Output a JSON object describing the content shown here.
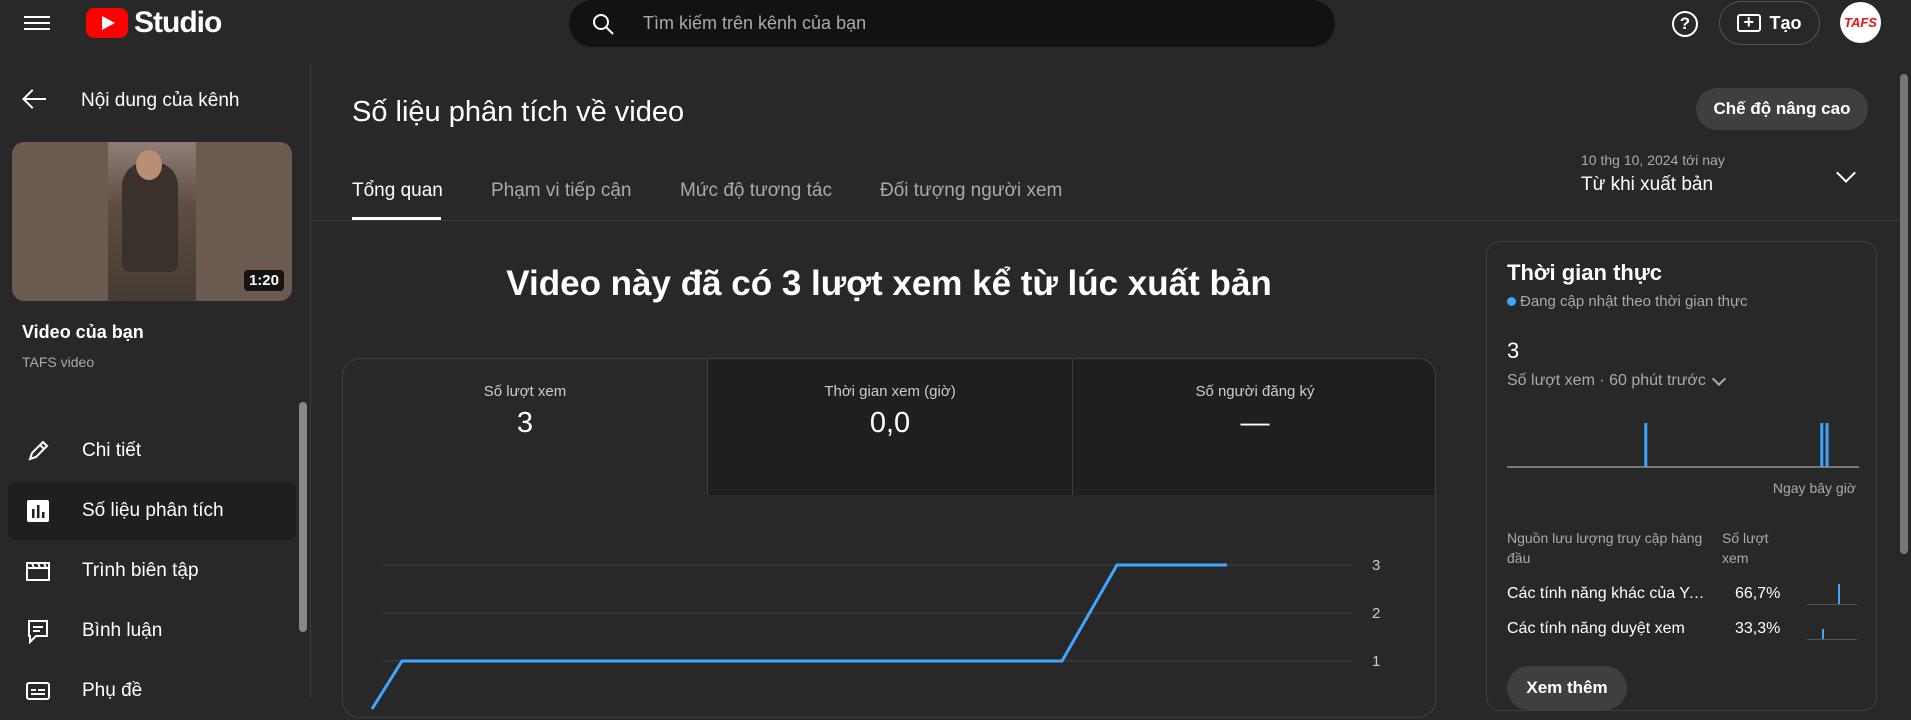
{
  "header": {
    "logo_text": "Studio",
    "search_placeholder": "Tìm kiếm trên kênh của bạn",
    "help_label": "?",
    "create_label": "Tạo",
    "avatar_text": "TAFS"
  },
  "sidebar": {
    "back_label": "Nội dung của kênh",
    "video_duration": "1:20",
    "video_title": "Video của bạn",
    "video_subtitle": "TAFS video",
    "items": [
      {
        "label": "Chi tiết",
        "icon": "pencil-icon"
      },
      {
        "label": "Số liệu phân tích",
        "icon": "analytics-icon"
      },
      {
        "label": "Trình biên tập",
        "icon": "editor-icon"
      },
      {
        "label": "Bình luận",
        "icon": "comments-icon"
      },
      {
        "label": "Phụ đề",
        "icon": "subtitles-icon"
      }
    ]
  },
  "main": {
    "title": "Số liệu phân tích về video",
    "advanced_button": "Chế độ nâng cao",
    "tabs": [
      {
        "label": "Tổng quan"
      },
      {
        "label": "Phạm vi tiếp cận"
      },
      {
        "label": "Mức độ tương tác"
      },
      {
        "label": "Đối tượng người xem"
      }
    ],
    "date_range": "10 thg 10, 2024 tới nay",
    "date_label": "Từ khi xuất bản",
    "headline": "Video này đã có 3 lượt xem kể từ lúc xuất bản",
    "stats": [
      {
        "label": "Số lượt xem",
        "value": "3"
      },
      {
        "label": "Thời gian xem (giờ)",
        "value": "0,0"
      },
      {
        "label": "Số người đăng ký",
        "value": "—"
      }
    ]
  },
  "chart_data": {
    "type": "line",
    "yticks": [
      "3",
      "2",
      "1"
    ],
    "ylim": [
      0,
      3
    ],
    "series": [
      {
        "values": [
          0,
          1,
          1,
          1,
          1,
          1,
          1,
          1,
          1,
          1,
          1,
          1,
          1,
          1,
          3,
          3,
          3
        ]
      }
    ],
    "color": "#3ea6ff"
  },
  "realtime": {
    "title": "Thời gian thực",
    "subtitle": "Đang cập nhật theo thời gian thực",
    "value": "3",
    "metric_label": "Số lượt xem · 60 phút trước",
    "now_label": "Ngay bây giờ",
    "bars": [
      {
        "position": 0.39,
        "value": 1
      },
      {
        "position": 0.89,
        "value": 1
      },
      {
        "position": 0.905,
        "value": 1
      }
    ],
    "table_headers": [
      "Nguồn lưu lượng truy cập hàng đầu",
      "Số lượt xem"
    ],
    "rows": [
      {
        "name": "Các tính năng khác của YouTube",
        "value": "66,7%",
        "fraction": 0.667
      },
      {
        "name": "Các tính năng duyệt xem",
        "value": "33,3%",
        "fraction": 0.333
      }
    ],
    "more_button": "Xem thêm"
  }
}
